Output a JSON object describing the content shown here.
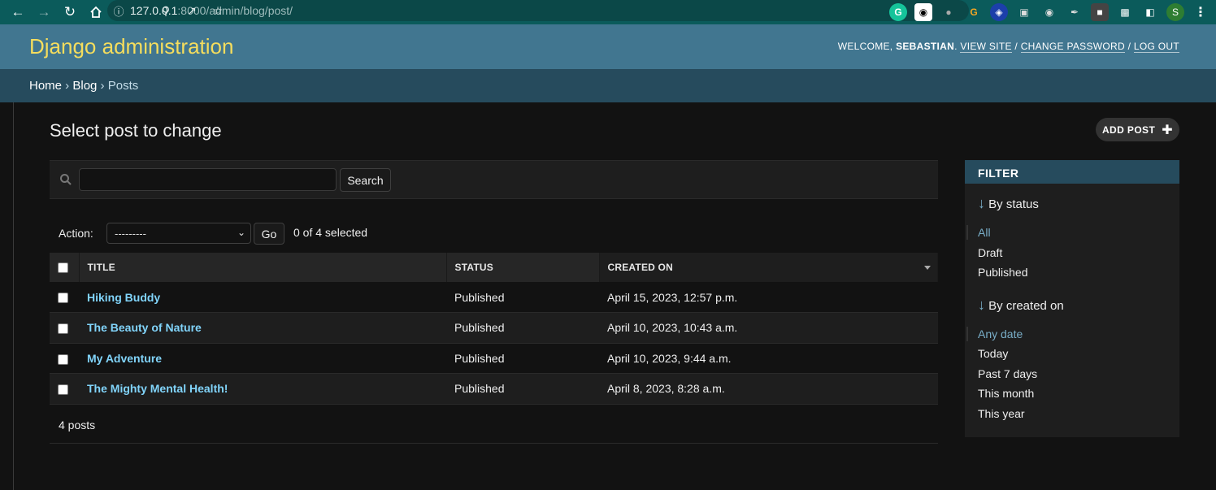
{
  "browser": {
    "url_host": "127.0.0.1",
    "url_rest": ":8000/admin/blog/post/",
    "profile_initial": "S"
  },
  "header": {
    "brand": "Django administration",
    "welcome": "WELCOME, ",
    "username": "SEBASTIAN",
    "view_site": "VIEW SITE",
    "change_password": "CHANGE PASSWORD",
    "log_out": "LOG OUT"
  },
  "breadcrumbs": {
    "home": "Home",
    "app": "Blog",
    "model": "Posts"
  },
  "page": {
    "title": "Select post to change",
    "add_button": "ADD POST"
  },
  "search": {
    "value": "",
    "button": "Search"
  },
  "actions": {
    "label": "Action:",
    "selected_option": "---------",
    "go": "Go",
    "counter": "0 of 4 selected"
  },
  "table": {
    "columns": [
      "TITLE",
      "STATUS",
      "CREATED ON"
    ],
    "rows": [
      {
        "title": "Hiking Buddy",
        "status": "Published",
        "created": "April 15, 2023, 12:57 p.m."
      },
      {
        "title": "The Beauty of Nature",
        "status": "Published",
        "created": "April 10, 2023, 10:43 a.m."
      },
      {
        "title": "My Adventure",
        "status": "Published",
        "created": "April 10, 2023, 9:44 a.m."
      },
      {
        "title": "The Mighty Mental Health!",
        "status": "Published",
        "created": "April 8, 2023, 8:28 a.m."
      }
    ]
  },
  "paginator": "4 posts",
  "filter": {
    "title": "FILTER",
    "status_heading": "By status",
    "status_options": [
      "All",
      "Draft",
      "Published"
    ],
    "created_heading": "By created on",
    "created_options": [
      "Any date",
      "Today",
      "Past 7 days",
      "This month",
      "This year"
    ]
  }
}
